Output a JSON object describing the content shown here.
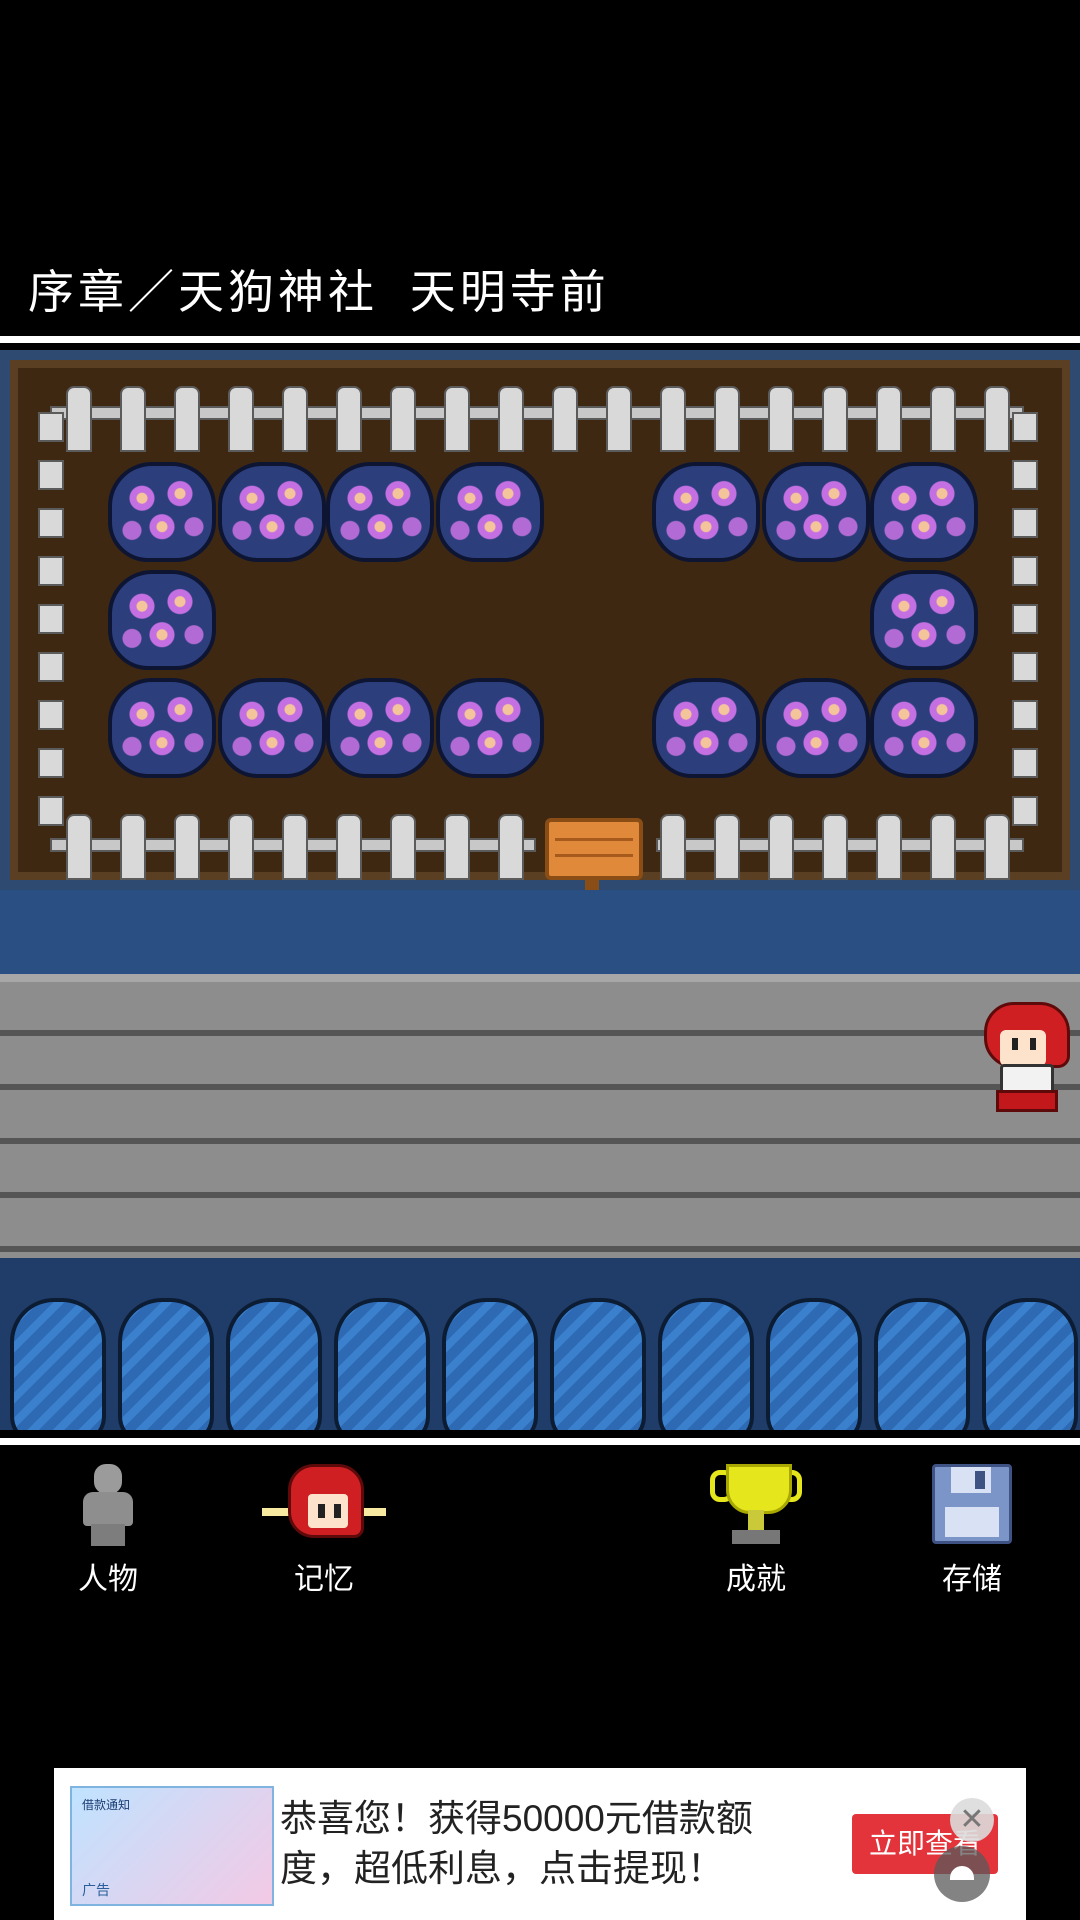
{
  "header": {
    "location_title": "序章／天狗神社 天明寺前"
  },
  "scene": {
    "background_colors": {
      "water": "#2a4f83",
      "soil": "#3f2812",
      "stone": "#8d8d8d",
      "hedge": "#2d6ab3"
    },
    "player_character": "red-haired-shrine-maiden-sprite",
    "signboard": "wooden-signboard-icon"
  },
  "menu": {
    "characters_label": "人物",
    "memories_label": "记忆",
    "achievements_label": "成就",
    "save_label": "存储"
  },
  "ad": {
    "thumb_title": "借款通知",
    "thumb_tag": "广告",
    "headline": "恭喜您！获得50000元借款额度，超低利息，点击提现！",
    "cta_label": "立即查看",
    "close_glyph": "✕",
    "accent_color": "#e3343c"
  }
}
